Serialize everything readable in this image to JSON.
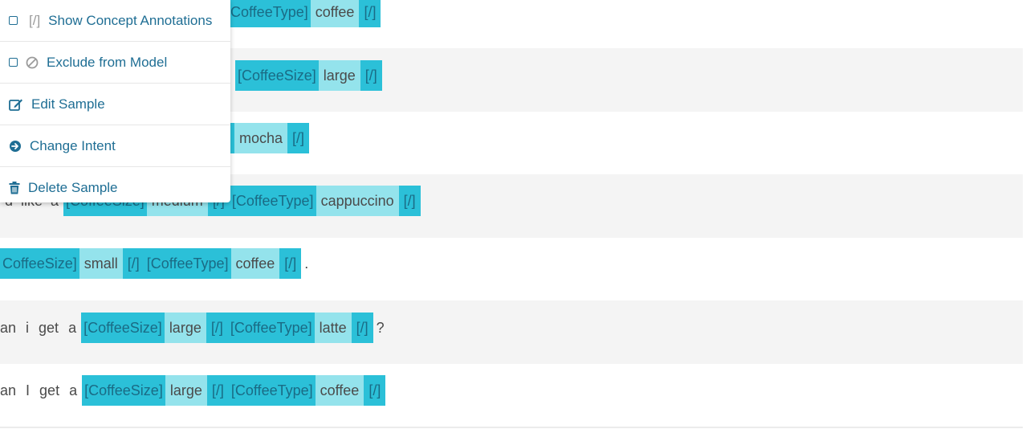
{
  "menu": {
    "show_annotations": {
      "prefix": "[/]",
      "label": "Show Concept Annotations"
    },
    "exclude": {
      "label": "Exclude from Model"
    },
    "edit": {
      "label": "Edit Sample"
    },
    "change_intent": {
      "label": "Change Intent"
    },
    "delete": {
      "label": "Delete Sample"
    }
  },
  "samples": [
    {
      "tag_a": "CoffeeType]",
      "val_a": "coffee",
      "end_a": "[/]"
    },
    {
      "tag_a": "[CoffeeSize]",
      "val_a": "large",
      "end_a": "[/]"
    },
    {
      "val_a": "mocha",
      "end_a": "[/]"
    },
    {
      "pre": "d  like  a",
      "tag_a": "[CoffeeSize]",
      "val_a": "medium",
      "end_a": "[/]",
      "tag_b": "[CoffeeType]",
      "val_b": "cappuccino",
      "end_b": "[/]"
    },
    {
      "tag_a": "CoffeeSize]",
      "val_a": "small",
      "end_a": "[/]",
      "tag_b": "[CoffeeType]",
      "val_b": "coffee",
      "end_b": "[/]",
      "post": "."
    },
    {
      "w1": "an",
      "w2": "i",
      "w3": "get",
      "w4": "a",
      "tag_a": "[CoffeeSize]",
      "val_a": "large",
      "end_a": "[/]",
      "tag_b": "[CoffeeType]",
      "val_b": "latte",
      "end_b": "[/]",
      "post": "?"
    },
    {
      "w1": "an",
      "w2": "I",
      "w3": "get",
      "w4": "a",
      "tag_a": "[CoffeeSize]",
      "val_a": "large",
      "end_a": "[/]",
      "tag_b": "[CoffeeType]",
      "val_b": "coffee",
      "end_b": "[/]"
    }
  ],
  "colors": {
    "tag_bg": "#2bc0d8",
    "value_bg": "#94e3ec",
    "menu_text": "#1f6e94",
    "alt_row": "#f4f4f4"
  },
  "icons": [
    "checkbox-icon",
    "ban-icon",
    "edit-icon",
    "arrow-circle-right-icon",
    "trash-icon"
  ]
}
